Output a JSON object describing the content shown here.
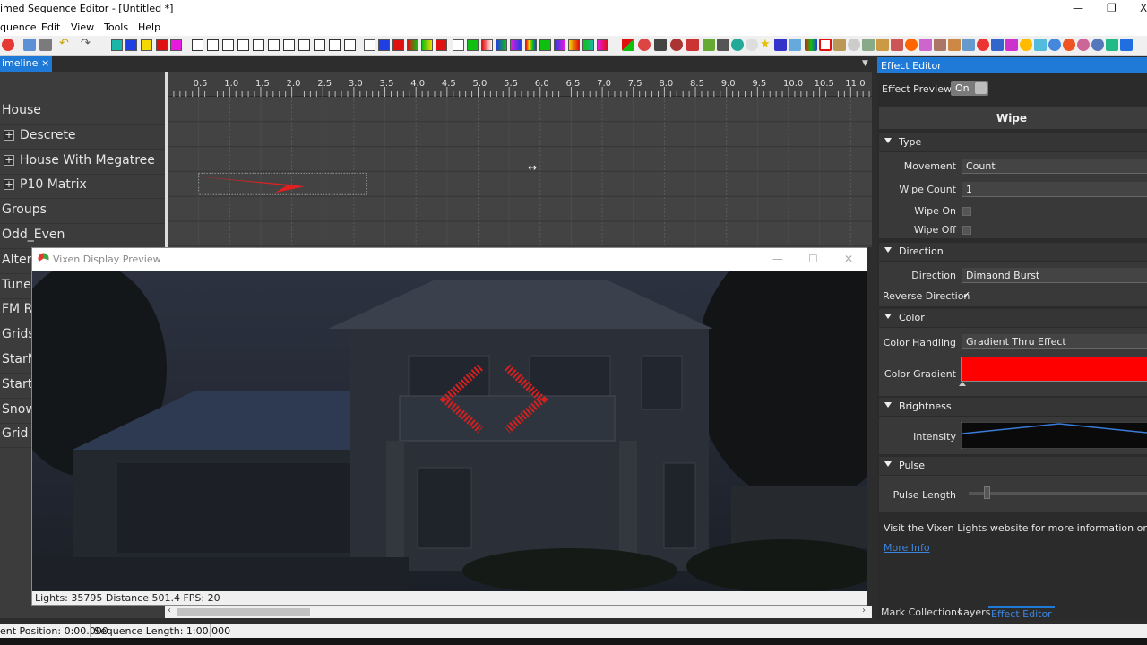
{
  "window": {
    "title": "imed Sequence Editor - [Untitled *]",
    "min_glyph": "—",
    "max_glyph": "❐",
    "close_glyph": "X"
  },
  "menu": [
    "quence",
    "Edit",
    "View",
    "Tools",
    "Help"
  ],
  "timeline": {
    "tab_label": "imeline",
    "tab_close": "×",
    "ruler_ticks": [
      "0.5",
      "1.0",
      "1.5",
      "2.0",
      "2.5",
      "3.0",
      "3.5",
      "4.0",
      "4.5",
      "5.0",
      "5.5",
      "6.0",
      "6.5",
      "7.0",
      "7.5",
      "8.0",
      "8.5",
      "9.0",
      "9.5",
      "10.0",
      "10.5",
      "11.0"
    ],
    "rows": [
      {
        "label": "House",
        "expand": false
      },
      {
        "label": "Descrete",
        "expand": true
      },
      {
        "label": "House With Megatree",
        "expand": true
      },
      {
        "label": "P10 Matrix",
        "expand": true
      },
      {
        "label": "Groups",
        "expand": false
      },
      {
        "label": "Odd_Even",
        "expand": false
      },
      {
        "label": "Altern",
        "expand": false
      },
      {
        "label": "Tune",
        "expand": false
      },
      {
        "label": "FM R",
        "expand": false
      },
      {
        "label": "Grids",
        "expand": false
      },
      {
        "label": "StarM",
        "expand": false
      },
      {
        "label": "Starto",
        "expand": false
      },
      {
        "label": "Snow",
        "expand": false
      },
      {
        "label": "Grid",
        "expand": false
      }
    ],
    "effect": {
      "name": "Wipe",
      "start_seconds": 0.5,
      "end_seconds": 3.2,
      "row": 3
    }
  },
  "preview": {
    "title": "Vixen Display Preview",
    "status": "Lights:  35795  Distance  501.4  FPS:  20"
  },
  "statusbar": {
    "position": "ent Position:  0:00.000",
    "length": "Sequence Length:  1:00.000"
  },
  "effect_editor": {
    "tab_title": "Effect Editor",
    "preview_label": "Effect Preview",
    "preview_toggle": "On",
    "effect_name": "Wipe",
    "sections": {
      "type": "Type",
      "direction": "Direction",
      "color": "Color",
      "brightness": "Brightness",
      "pulse": "Pulse"
    },
    "movement_label": "Movement",
    "movement_value": "Count",
    "wipe_count_label": "Wipe Count",
    "wipe_count_value": "1",
    "wipe_on_label": "Wipe On",
    "wipe_off_label": "Wipe Off",
    "direction_label": "Direction",
    "direction_value": "Dimaond Burst",
    "reverse_label": "Reverse Direction",
    "reverse_check": "✓",
    "color_handling_label": "Color Handling",
    "color_handling_value": "Gradient Thru Effect",
    "color_gradient_label": "Color Gradient",
    "gradient_color": "#ff0000",
    "intensity_label": "Intensity",
    "pulse_length_label": "Pulse Length",
    "info_text": "Visit the Vixen Lights website for more information on this effect",
    "more_info": "More Info",
    "bottom_tabs": [
      "Mark Collections",
      "Layers",
      "Effect Editor"
    ]
  },
  "colors": {
    "accent": "#1e7ad6",
    "effect_red": "#e02020"
  }
}
